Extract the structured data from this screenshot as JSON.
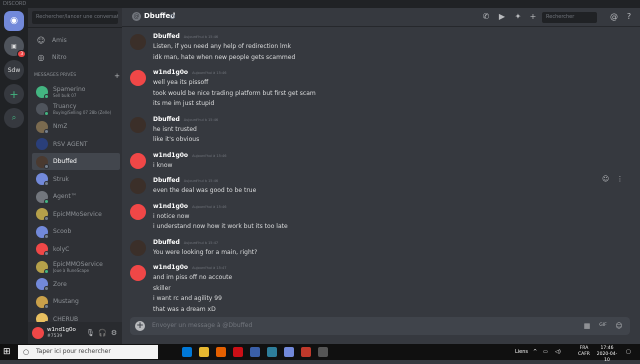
{
  "window": {
    "title": "DISCORD"
  },
  "guilds": [
    {
      "label": "",
      "badge": ""
    },
    {
      "label": "",
      "badge": "3"
    },
    {
      "label": "Sdw",
      "badge": ""
    }
  ],
  "sidebar": {
    "search_placeholder": "Rechercher/lancer une conversat...",
    "nav": [
      {
        "label": "Amis",
        "icon": "friends-icon"
      },
      {
        "label": "Nitro",
        "icon": "nitro-icon"
      }
    ],
    "dm_header": "MESSAGES PRIVÉS",
    "dms": [
      {
        "name": "Spamerino",
        "sub": "Sell bulk 07",
        "color": "#43b581",
        "status": "#43b581"
      },
      {
        "name": "Truancy",
        "sub": "Buying/Selling 07 28b (Zelle)",
        "color": "#4f545c",
        "status": "#43b581"
      },
      {
        "name": "NmZ",
        "sub": "",
        "color": "#7a6a4f",
        "status": "#747f8d"
      },
      {
        "name": "RSV AGENT",
        "sub": "",
        "color": "#2a3f7a",
        "status": ""
      },
      {
        "name": "Dbuffed",
        "sub": "",
        "color": "#4a3a30",
        "status": "#747f8d"
      },
      {
        "name": "Struk",
        "sub": "",
        "color": "#7289da",
        "status": "#747f8d"
      },
      {
        "name": "Agent™",
        "sub": "",
        "color": "#72767d",
        "status": "#43b581"
      },
      {
        "name": "EpicMMoService",
        "sub": "",
        "color": "#b5a04a",
        "status": "#747f8d"
      },
      {
        "name": "Scoob",
        "sub": "",
        "color": "#7289da",
        "status": "#747f8d"
      },
      {
        "name": "kolyC",
        "sub": "",
        "color": "#f04747",
        "status": "#747f8d"
      },
      {
        "name": "EpicMMOService",
        "sub": "Joue à RuneScape",
        "color": "#b5a04a",
        "status": "#43b581"
      },
      {
        "name": "Zore",
        "sub": "",
        "color": "#7289da",
        "status": "#747f8d"
      },
      {
        "name": "Mustang",
        "sub": "",
        "color": "#c9a04a",
        "status": "#747f8d"
      },
      {
        "name": "CHERUB",
        "sub": "",
        "color": "#e8c060",
        "status": "#747f8d"
      }
    ]
  },
  "user": {
    "name": "w1nd1g0o",
    "tag": "#7539"
  },
  "channel": {
    "title": "Dbuffed",
    "search_placeholder": "Rechercher"
  },
  "messages": [
    {
      "author": "Dbuffed",
      "time": "Aujourd'hui à 15:46",
      "avatar": "#3b2f29",
      "lines": [
        "Listen, if you need any help of redirection lmk",
        "idk man, hate when new people gets scammed"
      ]
    },
    {
      "author": "w1nd1g0o",
      "time": "Aujourd'hui à 15:46",
      "avatar": "#f04747",
      "lines": [
        "well yea its pissoff",
        "took would be nice trading platform but first get scam",
        "its me im just stupid"
      ]
    },
    {
      "author": "Dbuffed",
      "time": "Aujourd'hui à 15:46",
      "avatar": "#3b2f29",
      "lines": [
        "he isnt trusted",
        "like it's obvious"
      ]
    },
    {
      "author": "w1nd1g0o",
      "time": "Aujourd'hui à 15:46",
      "avatar": "#f04747",
      "lines": [
        "i know"
      ]
    },
    {
      "author": "Dbuffed",
      "time": "Aujourd'hui à 15:46",
      "avatar": "#3b2f29",
      "lines": [
        "even the deal was good to be true"
      ]
    },
    {
      "author": "w1nd1g0o",
      "time": "Aujourd'hui à 15:46",
      "avatar": "#f04747",
      "lines": [
        "i notice now",
        "i understand now how it work but its too late"
      ]
    },
    {
      "author": "Dbuffed",
      "time": "Aujourd'hui à 15:47",
      "avatar": "#3b2f29",
      "lines": [
        "You were looking for a main, right?"
      ]
    },
    {
      "author": "w1nd1g0o",
      "time": "Aujourd'hui à 15:47",
      "avatar": "#f04747",
      "lines": [
        "and im piss off no accoute",
        "skiller",
        "i want rc and agility 99",
        "that was a dream xD"
      ]
    }
  ],
  "composer": {
    "placeholder": "Envoyer un message à @Dbuffed"
  },
  "taskbar": {
    "search_placeholder": "Taper ici pour rechercher",
    "links": "Liens",
    "lang_1": "FRA",
    "lang_2": "CAFR",
    "time": "17:46",
    "date": "2020-04-10",
    "apps": [
      {
        "icon": "task-view-icon",
        "color": "#101010"
      },
      {
        "icon": "edge-icon",
        "color": "#0078d7"
      },
      {
        "icon": "file-explorer-icon",
        "color": "#e8b830"
      },
      {
        "icon": "firefox-icon",
        "color": "#e66000"
      },
      {
        "icon": "opera-icon",
        "color": "#cc0f16"
      },
      {
        "icon": "app-b-icon",
        "color": "#3a5fa8"
      },
      {
        "icon": "app-folder-icon",
        "color": "#2d7d9a"
      },
      {
        "icon": "discord-taskbar-icon",
        "color": "#7289da"
      },
      {
        "icon": "app-red-icon",
        "color": "#c0392b"
      },
      {
        "icon": "app-grey-icon",
        "color": "#555555"
      }
    ]
  }
}
